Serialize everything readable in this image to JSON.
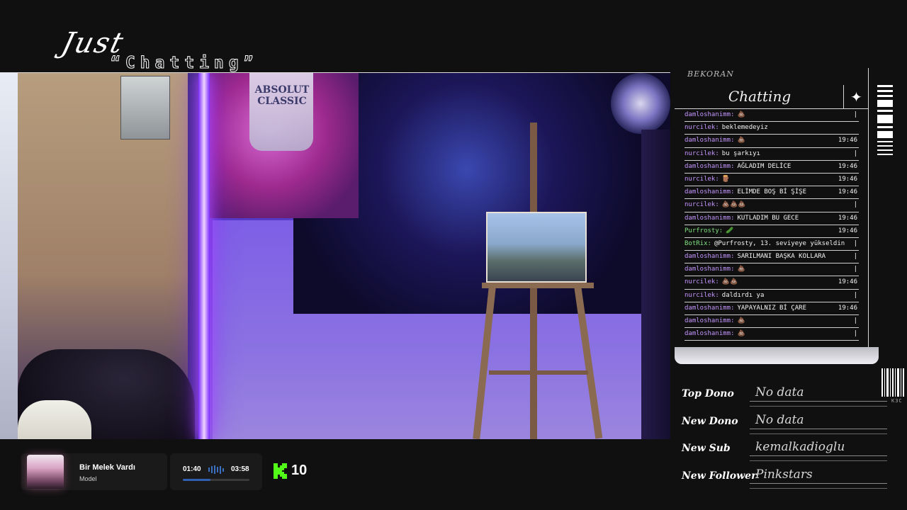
{
  "overlay": {
    "title_top": "Just",
    "title_bottom": "“Chatting”",
    "poster_text": "ABSOLUT\nCLASSIC"
  },
  "chat": {
    "username": "BEKORAN",
    "header": "Chatting",
    "messages": [
      {
        "user": "damloshanimm:",
        "msg": "💩",
        "time": "|",
        "color": "purple"
      },
      {
        "user": "nurcilek:",
        "msg": "beklemedeyiz",
        "time": "",
        "color": "purple"
      },
      {
        "user": "damloshanimm:",
        "msg": "💩",
        "time": "19:46",
        "color": "purple"
      },
      {
        "user": "nurcilek:",
        "msg": "bu şarkıyı",
        "time": "|",
        "color": "purple"
      },
      {
        "user": "damloshanimm:",
        "msg": "AĞLADIM DELİCE",
        "time": "19:46",
        "color": "purple"
      },
      {
        "user": "nurcilek:",
        "msg": "🪵",
        "time": "19:46",
        "color": "purple"
      },
      {
        "user": "damloshanimm:",
        "msg": "ELİMDE BOŞ Bİ ŞİŞE",
        "time": "19:46",
        "color": "purple"
      },
      {
        "user": "nurcilek:",
        "msg": "💩💩💩",
        "time": "|",
        "color": "purple"
      },
      {
        "user": "damloshanimm:",
        "msg": "KUTLADIM BU GECE",
        "time": "19:46",
        "color": "purple"
      },
      {
        "user": "Purfrosty:",
        "msg": "🥒",
        "time": "19:46",
        "color": "green"
      },
      {
        "user": "BotRix:",
        "msg": "@Purfrosty, 13. seviyeye yükseldin",
        "time": "|",
        "color": "green"
      },
      {
        "user": "damloshanimm:",
        "msg": "SARILMANI BAŞKA KOLLARA",
        "time": "|",
        "color": "purple"
      },
      {
        "user": "damloshanimm:",
        "msg": "💩",
        "time": "|",
        "color": "purple"
      },
      {
        "user": "nurcilek:",
        "msg": "💩💩",
        "time": "19:46",
        "color": "purple"
      },
      {
        "user": "nurcilek:",
        "msg": "daldırdı ya",
        "time": "|",
        "color": "purple"
      },
      {
        "user": "damloshanimm:",
        "msg": "YAPAYALNIZ Bİ ÇARE",
        "time": "19:46",
        "color": "purple"
      },
      {
        "user": "damloshanimm:",
        "msg": "💩",
        "time": "|",
        "color": "purple"
      },
      {
        "user": "damloshanimm:",
        "msg": "💩",
        "time": "|",
        "color": "purple"
      }
    ]
  },
  "stats": {
    "rows": [
      {
        "label": "Top Dono",
        "value": "No data"
      },
      {
        "label": "New Dono",
        "value": "No data"
      },
      {
        "label": "New Sub",
        "value": "kemalkadioglu"
      },
      {
        "label": "New Follower",
        "value": "Pinkstars"
      }
    ],
    "barcode_text": "K3C"
  },
  "music": {
    "title": "Bir Melek Vardı",
    "artist": "Model",
    "current_time": "01:40",
    "total_time": "03:58",
    "progress": 0.42
  },
  "kick": {
    "viewers": "10",
    "brand_color": "#53fc18"
  },
  "colors": {
    "chat_user": "#c596ff",
    "chat_user_alt": "#7fe07f"
  }
}
